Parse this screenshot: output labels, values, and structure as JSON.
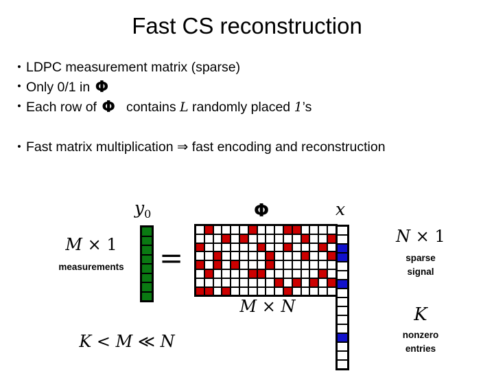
{
  "slide": {
    "title": "Fast CS reconstruction",
    "bullets": [
      {
        "id": "bullet-ldpc",
        "marker": "•",
        "parts": [
          {
            "kind": "text",
            "text": "LDPC measurement matrix (sparse)"
          }
        ]
      },
      {
        "id": "bullet-only01",
        "marker": "•",
        "parts": [
          {
            "kind": "text",
            "text": "Only 0/1 in "
          },
          {
            "kind": "phi",
            "text": "Φ"
          }
        ]
      },
      {
        "id": "bullet-eachrow",
        "marker": "•",
        "parts": [
          {
            "kind": "text",
            "text": "Each row of "
          },
          {
            "kind": "phi",
            "text": "Φ"
          },
          {
            "kind": "text",
            "text": "contains "
          },
          {
            "kind": "math",
            "text": "L"
          },
          {
            "kind": "text",
            "text": " randomly placed "
          },
          {
            "kind": "math",
            "text": "1"
          },
          {
            "kind": "text",
            "text": "’s"
          }
        ]
      },
      {
        "id": "bullet-fastmult",
        "marker": "•",
        "parts": [
          {
            "kind": "text",
            "text": "Fast matrix multiplication ⇒ fast encoding and reconstruction"
          }
        ]
      }
    ],
    "bullet_texts": {
      "ldpc": "LDPC measurement matrix (sparse)",
      "only01_pre": "Only 0/1 in ",
      "eachrow_pre": "Each row of ",
      "eachrow_mid": "contains ",
      "eachrow_L": "L",
      "eachrow_post": " randomly placed ",
      "eachrow_one": "1",
      "eachrow_tail": "’s",
      "fastmult": "Fast matrix multiplication ⇒ fast encoding and reconstruction"
    },
    "diagram": {
      "labels": {
        "y0": "y",
        "y0_sub": "0",
        "phi": "Φ",
        "x": "x",
        "equals": "=",
        "m_times_1": "M × 1",
        "m_times_1_sym": "M",
        "m_times_1_rest": " × 1",
        "measurements": "measurements",
        "m_times_n_sym": "M",
        "m_times_n_rest": " × ",
        "m_times_n_sym2": "N",
        "k_lt_m_ll_n_k": "K",
        "k_lt_m_ll_n_mid": " < ",
        "k_lt_m_ll_n_m": "M",
        "k_lt_m_ll_n_mid2": " ≪ ",
        "k_lt_m_ll_n_n": "N",
        "n_times_1_sym": "N",
        "n_times_1_rest": " × 1",
        "sparse_signal_line1": "sparse",
        "sparse_signal_line2": "signal",
        "k_symbol": "K",
        "nonzero_line1": "nonzero",
        "nonzero_line2": "entries"
      },
      "colors": {
        "measurement_vector": "#0a7a12",
        "matrix_nonzero": "#cc0000",
        "signal_nonzero": "#1111cc",
        "cell_border": "#000000",
        "cell_background": "#ffffff"
      },
      "measurement_vector": {
        "name": "y0",
        "rows": 8,
        "values": [
          1,
          1,
          1,
          1,
          1,
          1,
          1,
          1
        ]
      },
      "phi_matrix": {
        "name": "Phi",
        "rows": 8,
        "cols": 16,
        "cells": [
          [
            0,
            1,
            0,
            0,
            0,
            0,
            1,
            0,
            0,
            0,
            1,
            1,
            0,
            0,
            0,
            0
          ],
          [
            0,
            0,
            0,
            1,
            0,
            1,
            0,
            0,
            0,
            0,
            0,
            0,
            1,
            0,
            0,
            1
          ],
          [
            1,
            0,
            0,
            0,
            0,
            0,
            0,
            1,
            0,
            0,
            1,
            0,
            0,
            0,
            1,
            0
          ],
          [
            0,
            0,
            1,
            0,
            0,
            0,
            0,
            0,
            1,
            0,
            0,
            0,
            1,
            0,
            0,
            1
          ],
          [
            1,
            0,
            1,
            0,
            1,
            0,
            0,
            0,
            1,
            0,
            0,
            0,
            0,
            0,
            0,
            0
          ],
          [
            0,
            1,
            0,
            0,
            0,
            0,
            1,
            1,
            0,
            0,
            0,
            0,
            0,
            0,
            1,
            0
          ],
          [
            0,
            0,
            0,
            0,
            0,
            0,
            0,
            0,
            0,
            1,
            0,
            1,
            0,
            1,
            0,
            1
          ],
          [
            1,
            1,
            0,
            1,
            0,
            0,
            0,
            0,
            0,
            0,
            1,
            0,
            0,
            0,
            0,
            0
          ]
        ]
      },
      "signal_vector": {
        "name": "x",
        "rows": 16,
        "values": [
          0,
          0,
          1,
          1,
          0,
          0,
          1,
          0,
          0,
          0,
          0,
          0,
          1,
          0,
          0,
          0
        ]
      }
    }
  }
}
